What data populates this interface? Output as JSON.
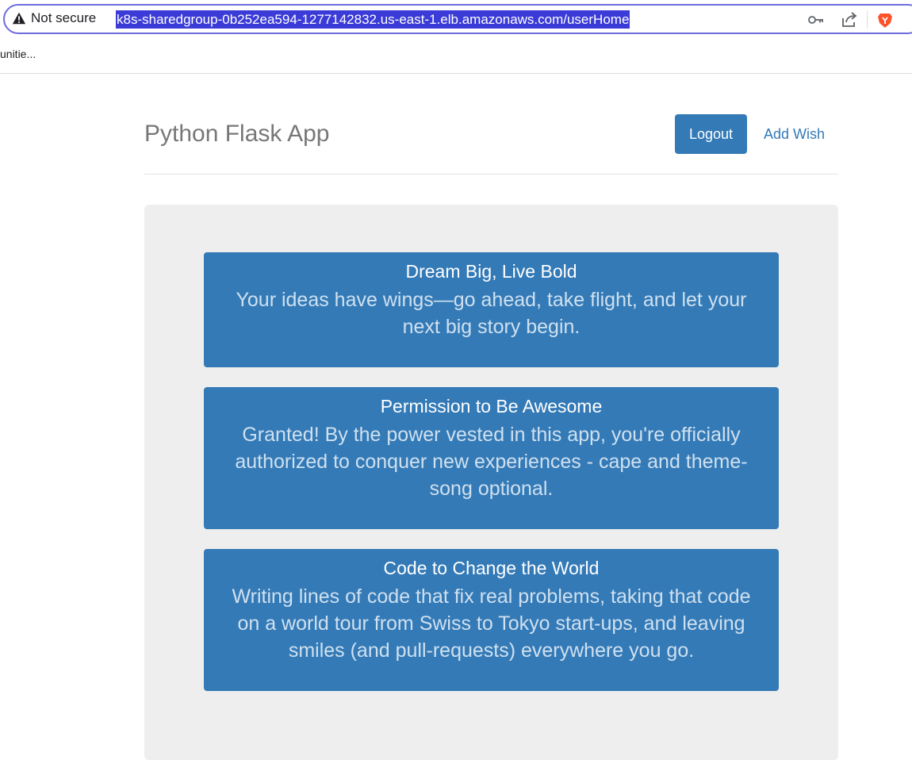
{
  "browser": {
    "security_label": "Not secure",
    "url": "k8s-sharedgroup-0b252ea594-1277142832.us-east-1.elb.amazonaws.com/userHome",
    "bookmark_label": "unitie...",
    "icons": [
      "warning-icon",
      "key-icon",
      "share-icon",
      "brave-icon"
    ]
  },
  "header": {
    "brand": "Python Flask App",
    "logout_label": "Logout",
    "add_wish_label": "Add Wish"
  },
  "wishes": [
    {
      "title": "Dream Big, Live Bold",
      "description": "Your ideas have wings—go ahead, take flight, and let your next big story begin."
    },
    {
      "title": "Permission to Be Awesome",
      "description": "Granted! By the power vested in this app, you're officially authorized to conquer new experiences - cape and theme-song optional."
    },
    {
      "title": "Code to Change the World",
      "description": "Writing lines of code that fix real problems, taking that code on a world tour from Swiss to Tokyo start-ups, and leaving smiles (and pull-requests) everywhere you go."
    }
  ],
  "colors": {
    "primary": "#337ab7",
    "jumbotron_bg": "#eeeeee",
    "url_highlight": "#3b3bd8"
  }
}
